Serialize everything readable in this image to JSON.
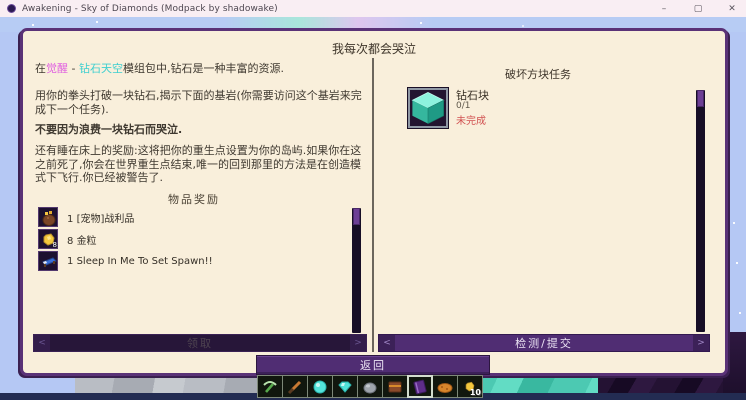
{
  "titlebar": {
    "title": "Awakening - Sky of Diamonds (Modpack by shadowake)",
    "minimize": "–",
    "maximize": "▢",
    "close": "✕"
  },
  "quest": {
    "window_title": "我每次都会哭泣",
    "left": {
      "p1": {
        "pre": "在",
        "world": "觉醒",
        "sep": " - ",
        "pack": "钻石天空",
        "post": "模组包中,钻石是一种丰富的资源."
      },
      "p2": "用你的拳头打破一块钻石,揭示下面的基岩(你需要访问这个基岩来完成下一个任务).",
      "p3": "不要因为浪费一块钻石而哭泣.",
      "p4": "还有睡在床上的奖励:这将把你的重生点设置为你的岛屿.如果你在这之前死了,你会在世界重生点结束,唯一的回到那里的方法是在创造模式下飞行.你已经被警告了.",
      "rewards_header": "物品奖励",
      "rewards": [
        {
          "qty": "1",
          "name": "[宠物]战利品",
          "icon": "loot-bag"
        },
        {
          "qty": "8",
          "name": "金粒",
          "icon": "gold-nugget",
          "badge": "8"
        },
        {
          "qty": "1",
          "name": "Sleep In Me To Set Spawn!!",
          "icon": "blue-bed"
        }
      ],
      "claim_button": "领取"
    },
    "right": {
      "header": "破坏方块任务",
      "task_name": "钻石块",
      "task_progress": "0/1",
      "task_status": "未完成",
      "task_icon": "diamond-block",
      "submit_button": "检测/提交"
    },
    "back_button": "返回",
    "arrow_left": "<",
    "arrow_right": ">"
  },
  "hotbar": {
    "selected_slot": 7,
    "slot_count_last": "10"
  },
  "colors": {
    "frame_purple": "#5a3277",
    "panel_cream": "#f9efdb",
    "button_purple": "#502d73",
    "claim_disabled_bg": "#271639",
    "highlight_magenta": "#e060e0",
    "highlight_aqua": "#3ecfcf",
    "status_red": "#d15050",
    "sky_blue": "#b5c8f4"
  }
}
